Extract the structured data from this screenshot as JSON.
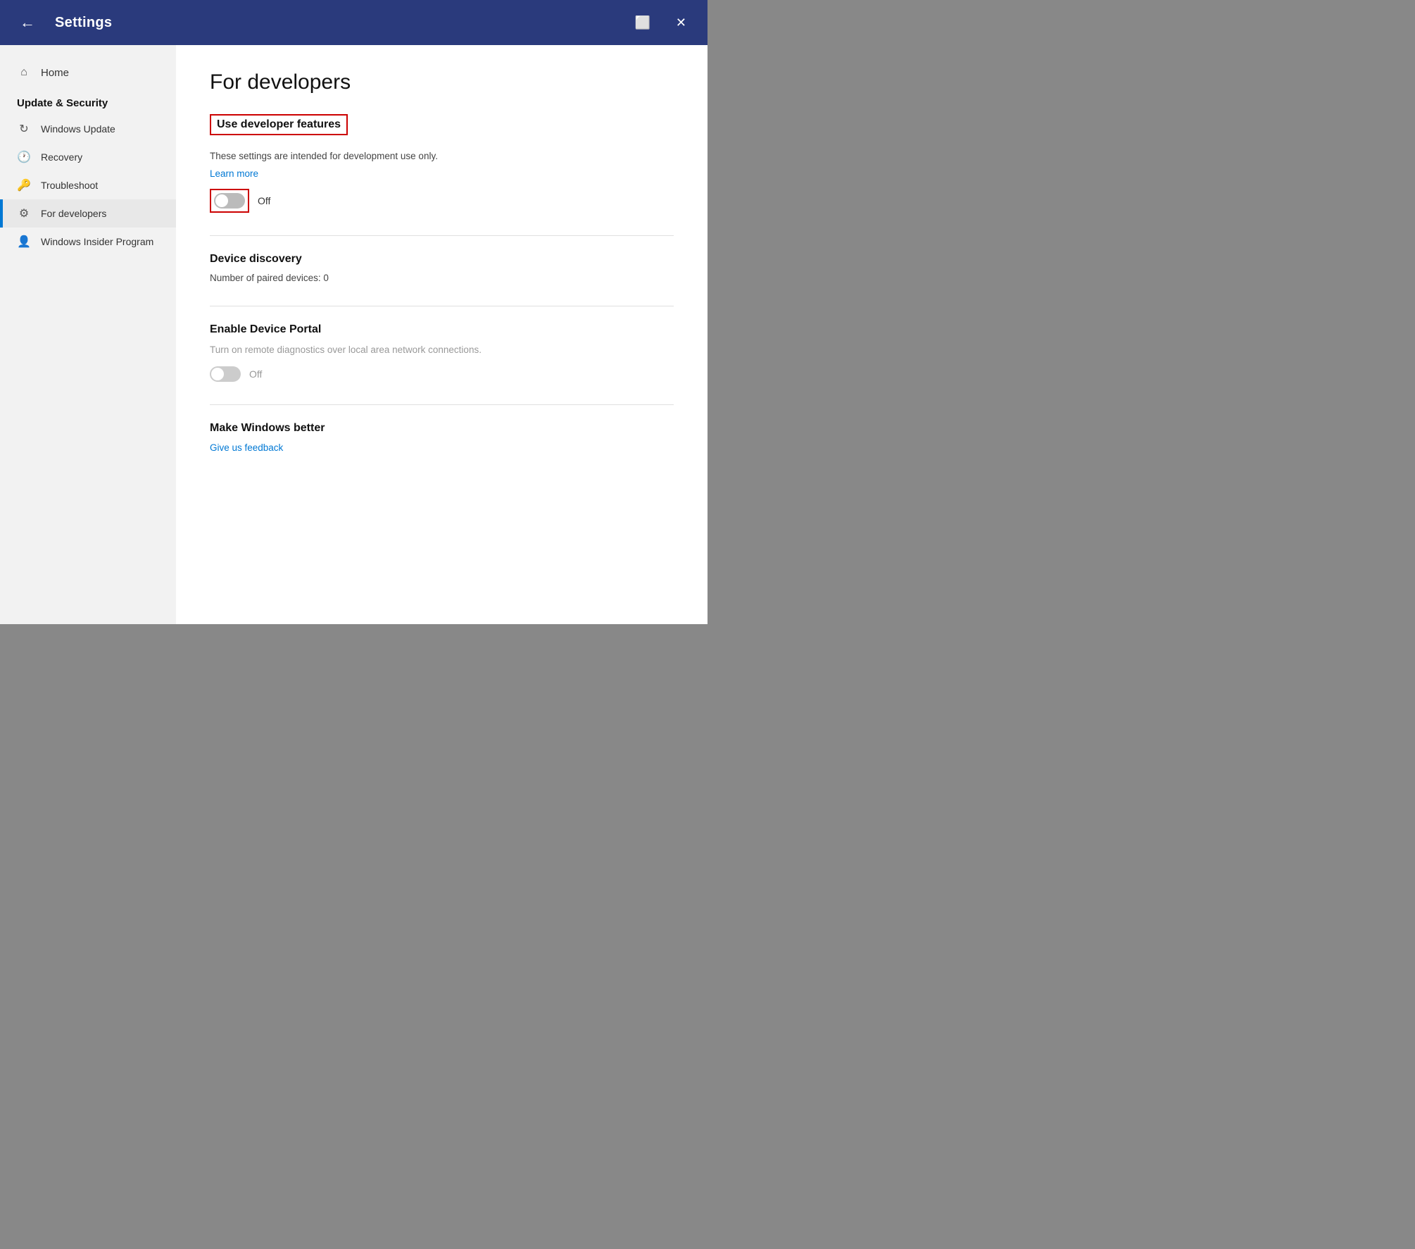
{
  "titlebar": {
    "back_label": "←",
    "title": "Settings",
    "snippet_icon": "⬜",
    "close_icon": "✕"
  },
  "sidebar": {
    "home_label": "Home",
    "section_title": "Update & Security",
    "items": [
      {
        "id": "windows-update",
        "label": "Windows Update",
        "icon": "↻"
      },
      {
        "id": "recovery",
        "label": "Recovery",
        "icon": "🕐"
      },
      {
        "id": "troubleshoot",
        "label": "Troubleshoot",
        "icon": "🔑"
      },
      {
        "id": "for-developers",
        "label": "For developers",
        "icon": "⚙",
        "active": true
      },
      {
        "id": "windows-insider",
        "label": "Windows Insider Program",
        "icon": "👤"
      }
    ]
  },
  "content": {
    "page_title": "For developers",
    "use_developer_features": {
      "heading": "Use developer features",
      "description": "These settings are intended for development use only.",
      "learn_more": "Learn more",
      "toggle_state": "off",
      "toggle_label": "Off"
    },
    "device_discovery": {
      "heading": "Device discovery",
      "paired_count": "Number of paired devices: 0"
    },
    "enable_device_portal": {
      "heading": "Enable Device Portal",
      "description": "Turn on remote diagnostics over local area network connections.",
      "toggle_state": "off",
      "toggle_label": "Off"
    },
    "make_windows_better": {
      "heading": "Make Windows better",
      "link": "Give us feedback"
    }
  }
}
